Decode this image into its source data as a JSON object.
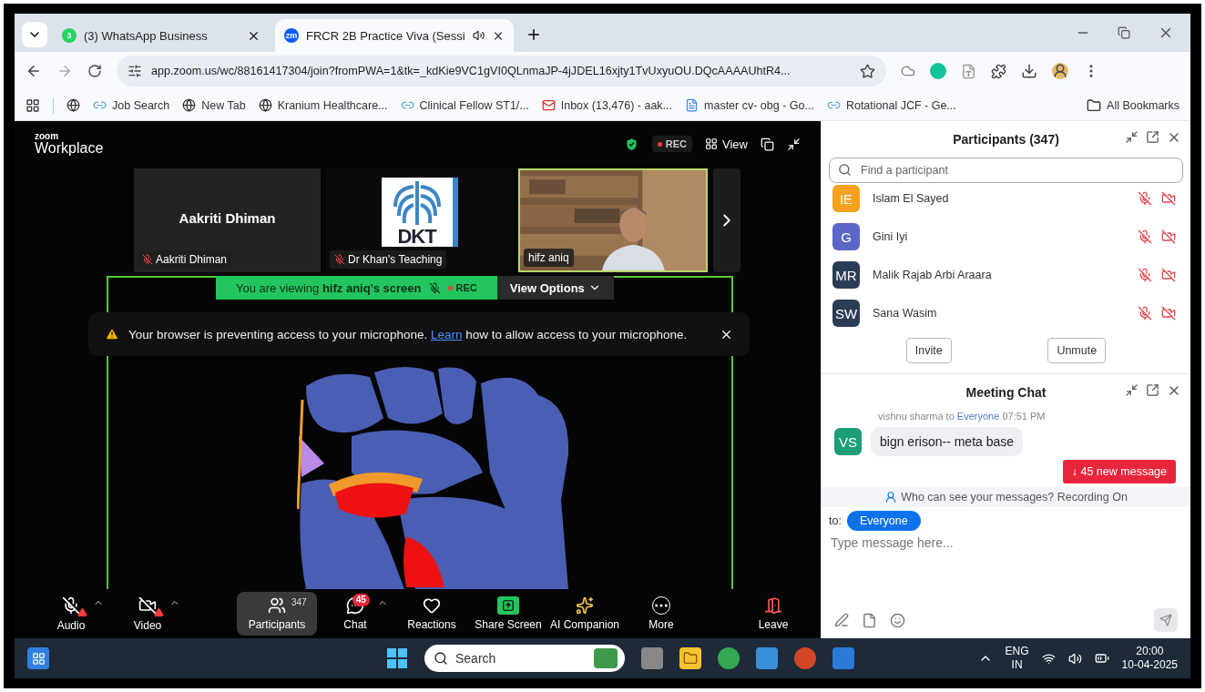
{
  "browser": {
    "tabs": [
      {
        "label": "(3) WhatsApp Business",
        "badge": "3",
        "selected": false
      },
      {
        "label": "FRCR 2B Practice Viva (Sessi",
        "favicon": "zm",
        "audio": true,
        "selected": true
      }
    ],
    "address": "app.zoom.us/wc/88161417304/join?fromPWA=1&tk=_kdKie9VC1gVI0QLnmaJP-4jJDEL16xjty1TvUxyuOU.DQcAAAAUhtR4...",
    "bookmarks": [
      {
        "kind": "globe"
      },
      {
        "kind": "link",
        "label": "Job Search"
      },
      {
        "kind": "globe",
        "label": "New Tab"
      },
      {
        "kind": "globe",
        "label": "Kranium Healthcare..."
      },
      {
        "kind": "link",
        "label": "Clinical Fellow ST1/..."
      },
      {
        "kind": "mail",
        "label": "Inbox (13,476) - aak..."
      },
      {
        "kind": "doc",
        "label": "master cv- obg - Go..."
      },
      {
        "kind": "link",
        "label": "Rotational JCF - Ge..."
      }
    ],
    "all_bookmarks": "All Bookmarks"
  },
  "zoom": {
    "logo_top": "zoom",
    "logo": "Workplace",
    "rec": "REC",
    "view": "View",
    "tiles": [
      {
        "kind": "name",
        "name": "Aakriti Dhiman",
        "label": "Aakriti Dhiman",
        "muted": true,
        "active": false
      },
      {
        "kind": "logo",
        "logo_text": "DKT",
        "label": "Dr Khan's Teaching",
        "muted": true,
        "active": false
      },
      {
        "kind": "video",
        "label": "hifz aniq",
        "muted": false,
        "active": true
      }
    ],
    "share_banner": {
      "text": "You are viewing **hifz aniq's screen**",
      "rec": "REC",
      "options": "View Options"
    },
    "alert": {
      "before": "Your browser is preventing access to your microphone.",
      "link": "Learn",
      "after": "how to allow access to your microphone."
    },
    "toolbar": [
      {
        "kind": "audio",
        "label": "Audio",
        "warning": true,
        "caret": true,
        "selected": false
      },
      {
        "kind": "video",
        "label": "Video",
        "warning": true,
        "caret": true,
        "selected": false
      },
      {
        "kind": "participants",
        "label": "Participants",
        "count": "347",
        "selected": true
      },
      {
        "kind": "chat",
        "label": "Chat",
        "badge": "45",
        "caret": true,
        "selected": false
      },
      {
        "kind": "reactions",
        "label": "Reactions",
        "selected": false
      },
      {
        "kind": "share",
        "label": "Share Screen",
        "selected": false
      },
      {
        "kind": "ai",
        "label": "AI Companion",
        "selected": false
      },
      {
        "kind": "more",
        "label": "More",
        "selected": false
      },
      {
        "kind": "leave",
        "label": "Leave",
        "selected": false
      }
    ]
  },
  "participants": {
    "title": "Participants (347)",
    "placeholder": "Find a participant",
    "people": [
      {
        "initials": "IE",
        "name": "Islam El Sayed",
        "color": "#f5a11f",
        "muted": true,
        "video_off": true
      },
      {
        "initials": "G",
        "name": "Gini Iyi",
        "color": "#5b66c8",
        "muted": true,
        "video_off": true
      },
      {
        "initials": "MR",
        "name": "Malik Rajab Arbi Araara",
        "color": "#2b3d55",
        "muted": true,
        "video_off": true
      },
      {
        "initials": "SW",
        "name": "Sana Wasim",
        "color": "#2b3d55",
        "muted": true,
        "video_off": true
      }
    ],
    "buttons": [
      "Invite",
      "Unmute"
    ]
  },
  "chat": {
    "title": "Meeting Chat",
    "messages": [
      {
        "sender": "vishnu sharma",
        "to": "to",
        "recipient": "Everyone",
        "time": "07:51 PM",
        "initials": "VS",
        "color": "#1e9e78",
        "text": "bign erison-- meta base"
      }
    ],
    "new_messages": "↓ 45 new message",
    "privacy": "Who can see your messages? Recording On",
    "to_label": "to:",
    "recipient": "Everyone",
    "placeholder": "Type message here..."
  },
  "taskbar": {
    "placeholder": "Search",
    "lang": "ENG",
    "region": "IN",
    "time": "20:00",
    "date": "10-04-2025"
  }
}
